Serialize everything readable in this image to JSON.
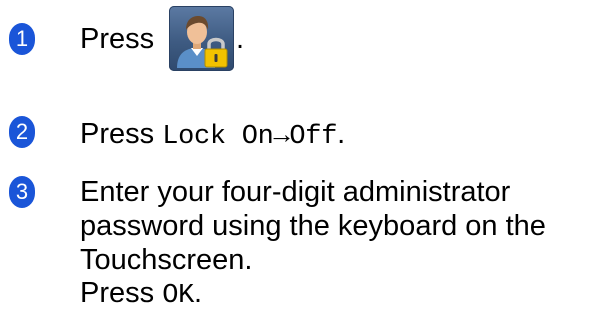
{
  "steps": [
    {
      "number": "1",
      "text_before_icon": "Press",
      "text_after_icon": ".",
      "icon": "user-lock-icon"
    },
    {
      "number": "2",
      "text_before_code": "Press ",
      "code": "Lock On→Off",
      "text_after_code": "."
    },
    {
      "number": "3",
      "lines": [
        "Enter your four-digit administrator",
        "password using the keyboard on the",
        "Touchscreen."
      ],
      "press_prefix": "Press ",
      "press_code": "OK",
      "press_suffix": "."
    }
  ],
  "colors": {
    "badge": "#1a55d8",
    "icon_background": "#4a6890",
    "lock": "#f2c200"
  }
}
